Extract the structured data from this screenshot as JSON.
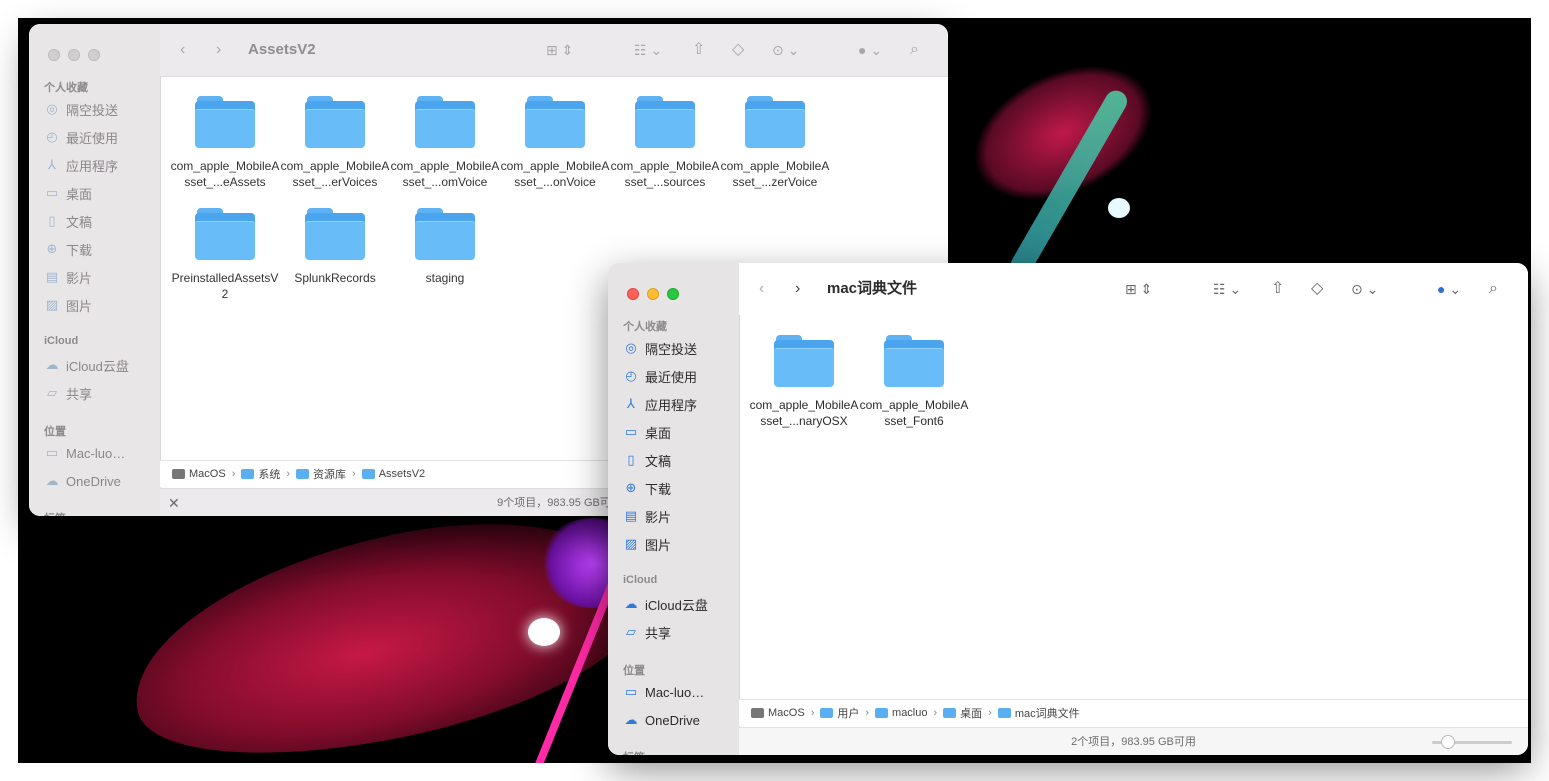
{
  "window_back": {
    "title": "AssetsV2",
    "sidebar": {
      "favorites_header": "个人收藏",
      "favorites": [
        {
          "label": "隔空投送",
          "icon": "airdrop-icon"
        },
        {
          "label": "最近使用",
          "icon": "clock-icon"
        },
        {
          "label": "应用程序",
          "icon": "applications-icon"
        },
        {
          "label": "桌面",
          "icon": "desktop-icon"
        },
        {
          "label": "文稿",
          "icon": "document-icon"
        },
        {
          "label": "下载",
          "icon": "download-icon"
        },
        {
          "label": "影片",
          "icon": "film-icon"
        },
        {
          "label": "图片",
          "icon": "photo-icon"
        }
      ],
      "icloud_header": "iCloud",
      "icloud": [
        {
          "label": "iCloud云盘",
          "icon": "cloud-icon"
        },
        {
          "label": "共享",
          "icon": "shared-folder-icon"
        }
      ],
      "locations_header": "位置",
      "locations": [
        {
          "label": "Mac-luo…",
          "icon": "disk-icon"
        },
        {
          "label": "OneDrive",
          "icon": "cloud-icon"
        }
      ],
      "tags_header_partial": "标签"
    },
    "files": [
      "com_apple_MobileAsset_...eAssets",
      "com_apple_MobileAsset_...erVoices",
      "com_apple_MobileAsset_...omVoice",
      "com_apple_MobileAsset_...onVoice",
      "com_apple_MobileAsset_...sources",
      "com_apple_MobileAsset_...zerVoice",
      "PreinstalledAssetsV2",
      "SplunkRecords",
      "staging"
    ],
    "path": [
      "MacOS",
      "系统",
      "资源库",
      "AssetsV2"
    ],
    "status": "9个项目，983.95 GB可"
  },
  "window_front": {
    "title": "mac词典文件",
    "sidebar": {
      "favorites_header": "个人收藏",
      "favorites": [
        {
          "label": "隔空投送",
          "icon": "airdrop-icon"
        },
        {
          "label": "最近使用",
          "icon": "clock-icon"
        },
        {
          "label": "应用程序",
          "icon": "applications-icon"
        },
        {
          "label": "桌面",
          "icon": "desktop-icon"
        },
        {
          "label": "文稿",
          "icon": "document-icon"
        },
        {
          "label": "下载",
          "icon": "download-icon"
        },
        {
          "label": "影片",
          "icon": "film-icon"
        },
        {
          "label": "图片",
          "icon": "photo-icon"
        }
      ],
      "icloud_header": "iCloud",
      "icloud": [
        {
          "label": "iCloud云盘",
          "icon": "cloud-icon"
        },
        {
          "label": "共享",
          "icon": "shared-folder-icon"
        }
      ],
      "locations_header": "位置",
      "locations": [
        {
          "label": "Mac-luo…",
          "icon": "disk-icon"
        },
        {
          "label": "OneDrive",
          "icon": "cloud-icon"
        }
      ],
      "tags_header_partial": "标签"
    },
    "files": [
      "com_apple_MobileAsset_...naryOSX",
      "com_apple_MobileAsset_Font6"
    ],
    "path": [
      "MacOS",
      "用户",
      "macluo",
      "桌面",
      "mac词典文件"
    ],
    "status": "2个项目，983.95 GB可用",
    "icon_size_slider": 0.2
  }
}
